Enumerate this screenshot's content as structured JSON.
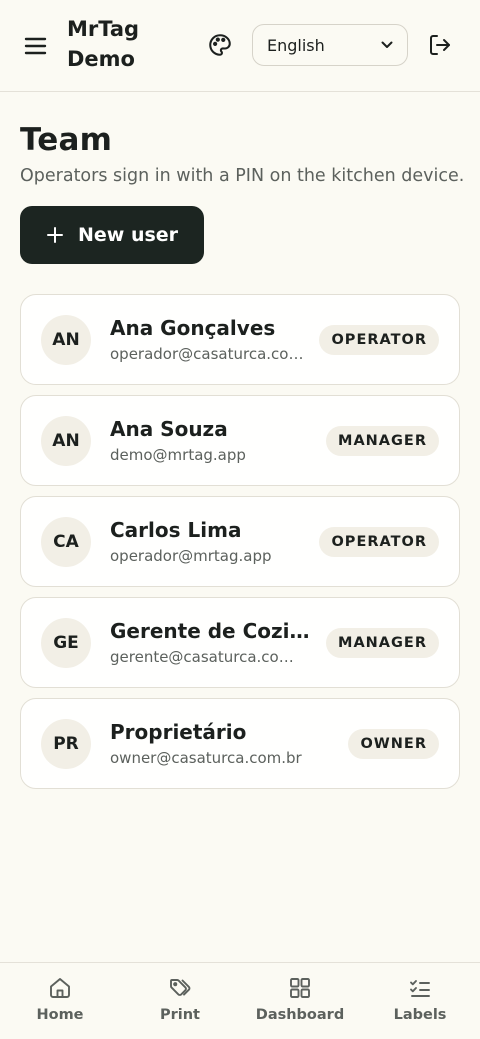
{
  "header": {
    "brand": "MrTag Demo",
    "language": "English"
  },
  "main": {
    "title": "Team",
    "subtitle": "Operators sign in with a PIN on the kitchen device.",
    "new_user_label": "New user"
  },
  "users": [
    {
      "initials": "AN",
      "name": "Ana Gonçalves",
      "email": "operador@casaturca.com.br",
      "role": "OPERATOR"
    },
    {
      "initials": "AN",
      "name": "Ana Souza",
      "email": "demo@mrtag.app",
      "role": "MANAGER"
    },
    {
      "initials": "CA",
      "name": "Carlos Lima",
      "email": "operador@mrtag.app",
      "role": "OPERATOR"
    },
    {
      "initials": "GE",
      "name": "Gerente de Cozinha",
      "email": "gerente@casaturca.com.br",
      "role": "MANAGER"
    },
    {
      "initials": "PR",
      "name": "Proprietário",
      "email": "owner@casaturca.com.br",
      "role": "OWNER"
    }
  ],
  "bottom_nav": [
    {
      "label": "Home",
      "icon": "home-icon"
    },
    {
      "label": "Print",
      "icon": "tags-icon"
    },
    {
      "label": "Dashboard",
      "icon": "grid-icon"
    },
    {
      "label": "Labels",
      "icon": "list-check-icon"
    }
  ]
}
